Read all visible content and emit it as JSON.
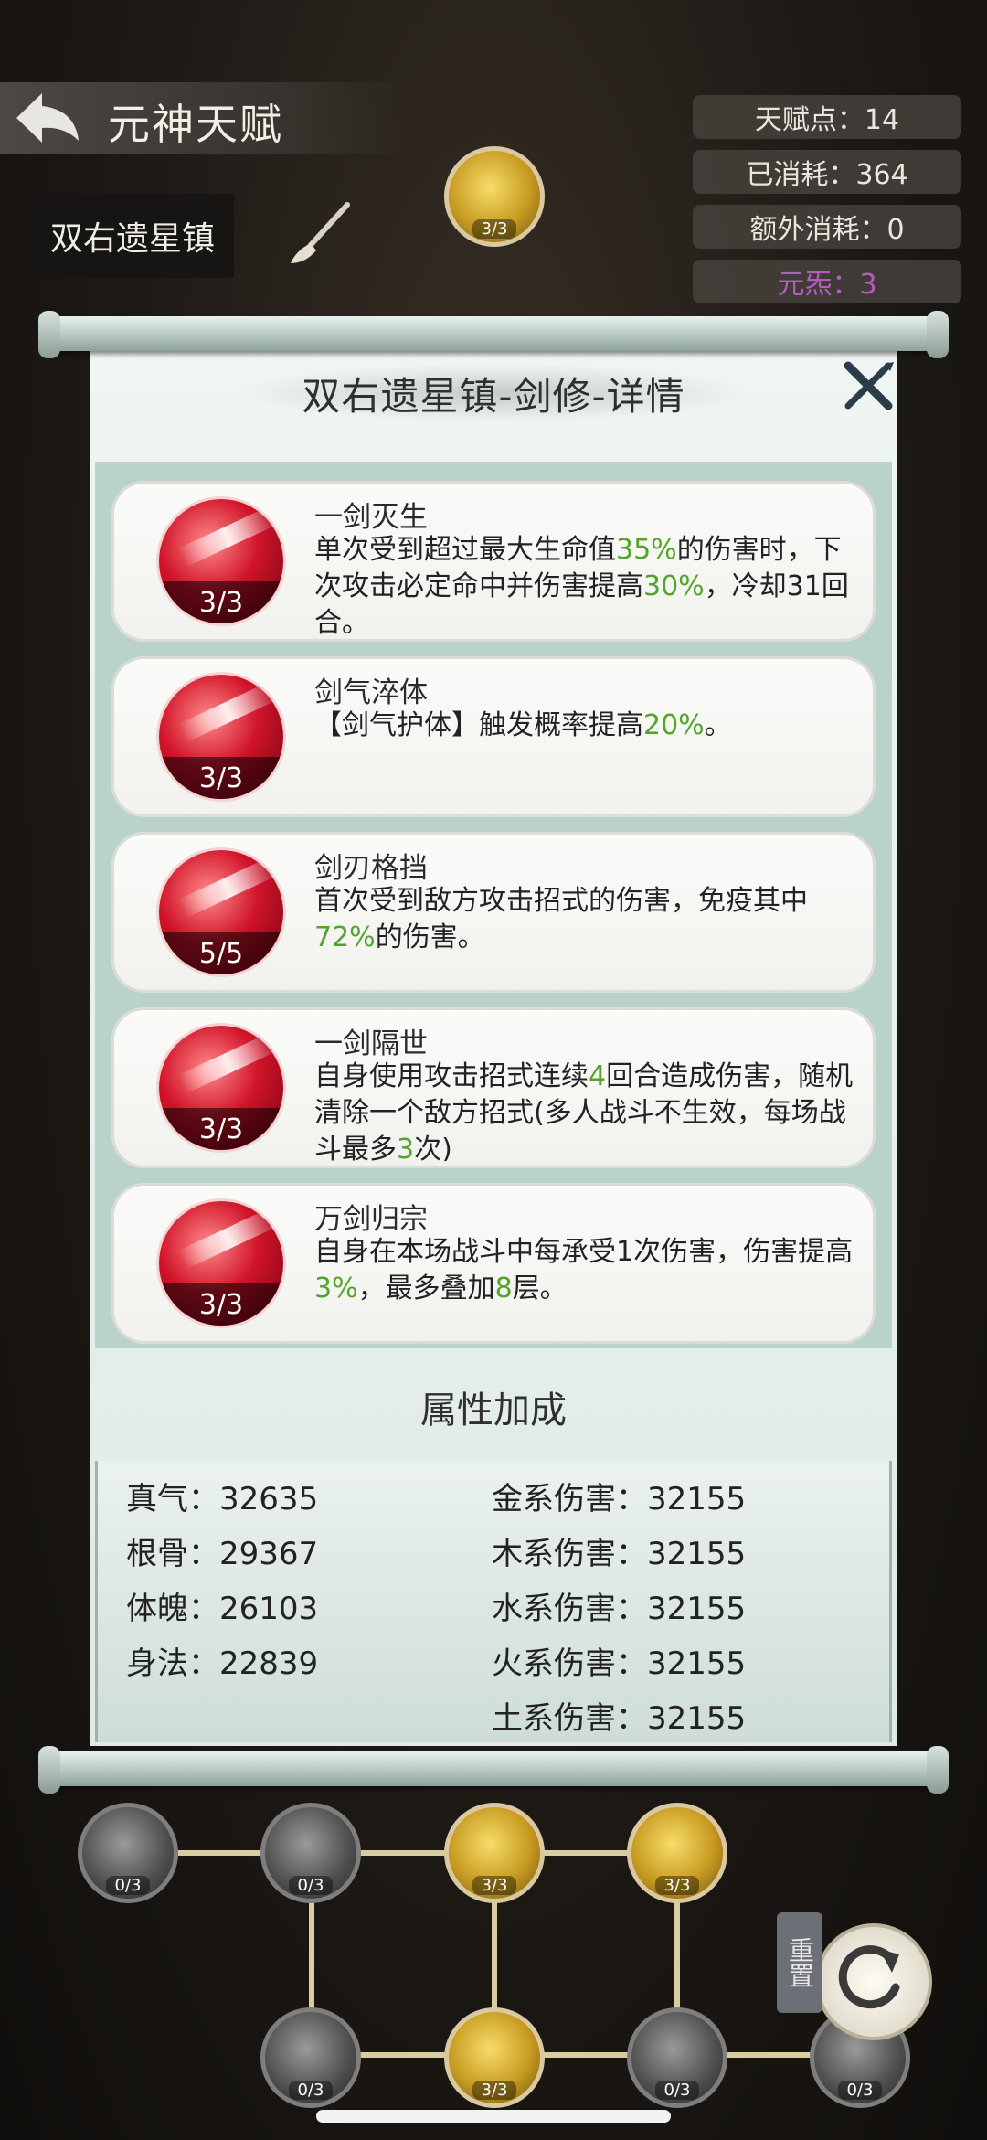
{
  "header": {
    "title": "元神天赋",
    "location": "双右遗星镇"
  },
  "stats": [
    {
      "label": "天赋点：14"
    },
    {
      "label": "已消耗：364"
    },
    {
      "label": "额外消耗：0"
    },
    {
      "label": "元炁：3"
    }
  ],
  "tree_top": {
    "count": "3/3"
  },
  "panel": {
    "title": "双右遗星镇-剑修-详情",
    "skills": [
      {
        "name": "一剑灭生",
        "level": "3/3",
        "desc_parts": [
          "单次受到超过最大生命值",
          "35%",
          "的伤害时，下次攻击必定命中并伤害提高",
          "30%",
          "，冷却31回合。"
        ]
      },
      {
        "name": "剑气淬体",
        "level": "3/3",
        "desc_parts": [
          "【剑气护体】触发概率提高",
          "20%",
          "。"
        ]
      },
      {
        "name": "剑刃格挡",
        "level": "5/5",
        "desc_parts": [
          "首次受到敌方攻击招式的伤害，免疫其中",
          "72%",
          "的伤害。"
        ]
      },
      {
        "name": "一剑隔世",
        "level": "3/3",
        "desc_parts": [
          "自身使用攻击招式连续",
          "4",
          "回合造成伤害，随机清除一个敌方招式(多人战斗不生效，每场战斗最多",
          "3",
          "次)"
        ]
      },
      {
        "name": "万剑归宗",
        "level": "3/3",
        "desc_parts": [
          "自身在本场战斗中每承受1次伤害，伤害提高",
          "3%",
          "，最多叠加",
          "8",
          "层。"
        ]
      }
    ],
    "attr_title": "属性加成",
    "attrs_left": [
      {
        "text": "真气：32635"
      },
      {
        "text": "根骨：29367"
      },
      {
        "text": "体魄：26103"
      },
      {
        "text": "身法：22839"
      }
    ],
    "attrs_right": [
      {
        "text": "金系伤害：32155"
      },
      {
        "text": "木系伤害：32155"
      },
      {
        "text": "水系伤害：32155"
      },
      {
        "text": "火系伤害：32155"
      },
      {
        "text": "土系伤害：32155"
      }
    ]
  },
  "tree_bottom": {
    "row1": [
      "0/3",
      "0/3",
      "3/3",
      "3/3"
    ],
    "row2": [
      "0/3",
      "3/3",
      "0/3",
      "0/3"
    ]
  },
  "reset_label": "重置",
  "colors": {
    "highlight": "#55a42a",
    "stat_purple": "#b45cc0"
  }
}
